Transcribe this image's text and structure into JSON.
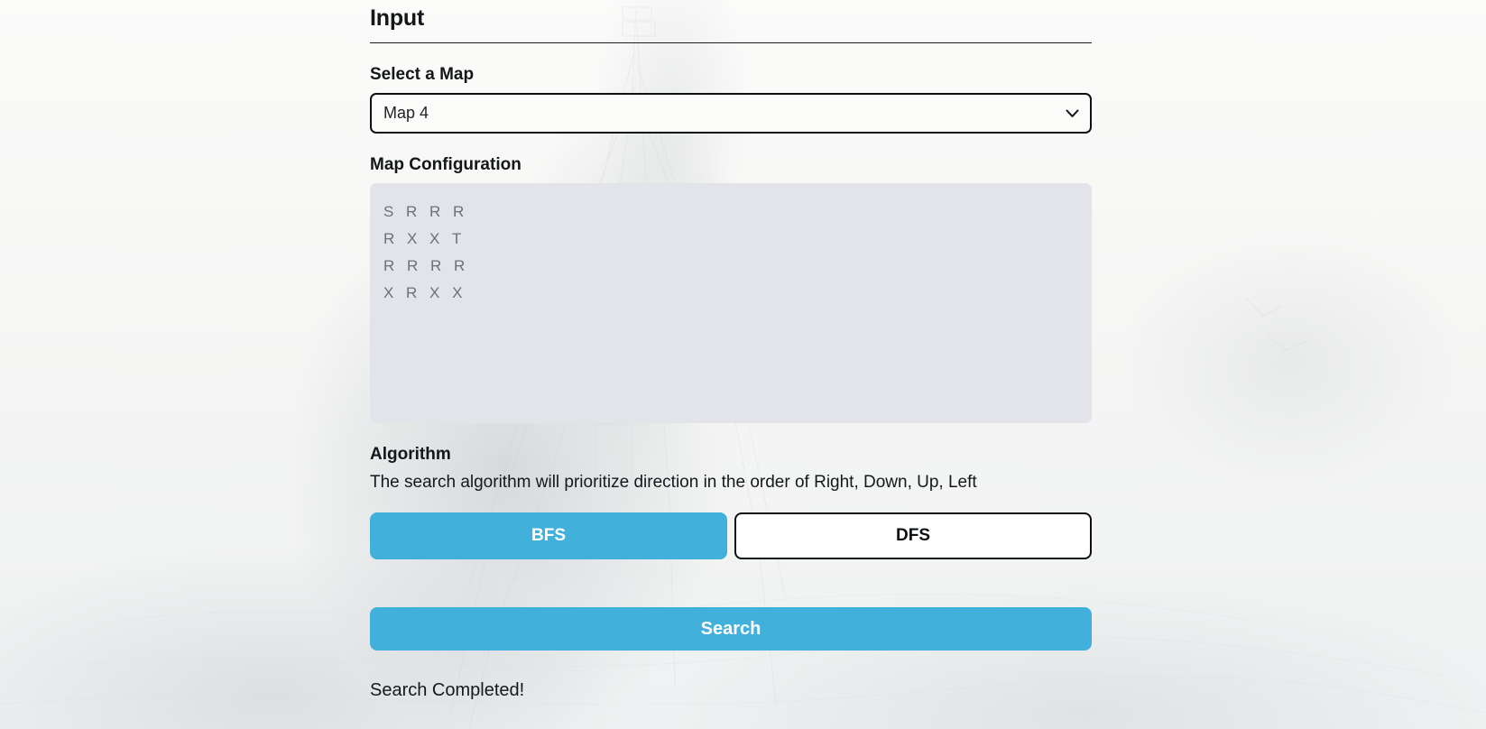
{
  "panel": {
    "title": "Input"
  },
  "map_select": {
    "label": "Select a Map",
    "value": "Map 4",
    "chevron": "chevron-down-icon",
    "options": [
      "Map 4"
    ]
  },
  "map_config": {
    "label": "Map Configuration",
    "value": "S R R R\nR X X T\nR R R R\nX R X X",
    "rows": [
      [
        "S",
        "R",
        "R",
        "R"
      ],
      [
        "R",
        "X",
        "X",
        "T"
      ],
      [
        "R",
        "R",
        "R",
        "R"
      ],
      [
        "X",
        "R",
        "X",
        "X"
      ]
    ]
  },
  "algorithm": {
    "label": "Algorithm",
    "description": "The search algorithm will prioritize direction in the order of Right, Down, Up, Left",
    "options": [
      {
        "label": "BFS",
        "selected": true
      },
      {
        "label": "DFS",
        "selected": false
      }
    ]
  },
  "actions": {
    "search_label": "Search"
  },
  "status": {
    "message": "Search Completed!"
  },
  "colors": {
    "accent": "#41b0da",
    "text": "#16191c",
    "textarea_bg": "#e3e4e9",
    "textarea_text": "#6b7079",
    "page_bg": "#f7f7f6"
  }
}
